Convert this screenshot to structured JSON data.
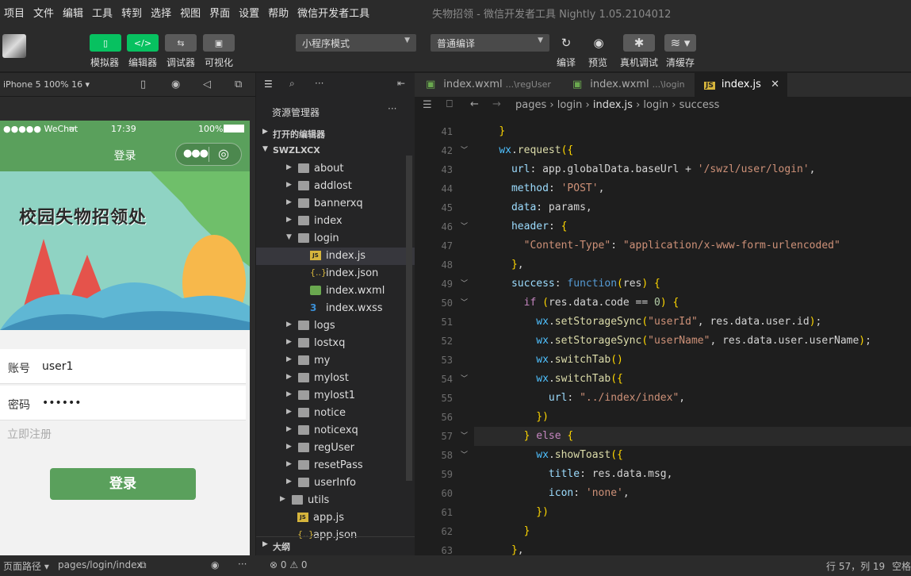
{
  "menu": [
    "项目",
    "文件",
    "编辑",
    "工具",
    "转到",
    "选择",
    "视图",
    "界面",
    "设置",
    "帮助",
    "微信开发者工具"
  ],
  "app_title": "失物招领 - 微信开发者工具 Nightly 1.05.2104012",
  "toolbar": {
    "simulator": "模拟器",
    "editor": "编辑器",
    "debugger": "调试器",
    "visual": "可视化",
    "mode_select": "小程序模式",
    "compile_select": "普通编译",
    "compile": "编译",
    "preview": "预览",
    "remote_debug": "真机调试",
    "clear_cache": "清缓存"
  },
  "simulator": {
    "device": "iPhone 5 100% 16 ▾",
    "carrier": "●●●●● WeChat",
    "time": "17:39",
    "battery": "100%",
    "nav_title": "登录",
    "banner_title": "校园失物招领处",
    "account_label": "账号",
    "account_value": "user1",
    "password_label": "密码",
    "password_value": "••••••",
    "register_link": "立即注册",
    "login_button": "登录"
  },
  "explorer": {
    "title": "资源管理器",
    "open_editors": "打开的编辑器",
    "project": "SWZLXCX",
    "outline": "大纲",
    "items": [
      {
        "name": "about",
        "type": "folder",
        "indent": 1,
        "open": false
      },
      {
        "name": "addlost",
        "type": "folder",
        "indent": 1,
        "open": false
      },
      {
        "name": "bannerxq",
        "type": "folder",
        "indent": 1,
        "open": false
      },
      {
        "name": "index",
        "type": "folder",
        "indent": 1,
        "open": false
      },
      {
        "name": "login",
        "type": "folder",
        "indent": 1,
        "open": true
      },
      {
        "name": "index.js",
        "type": "js",
        "indent": 2,
        "selected": true
      },
      {
        "name": "index.json",
        "type": "json",
        "indent": 2
      },
      {
        "name": "index.wxml",
        "type": "wxml",
        "indent": 2
      },
      {
        "name": "index.wxss",
        "type": "wxss",
        "indent": 2
      },
      {
        "name": "logs",
        "type": "folder",
        "indent": 1,
        "open": false
      },
      {
        "name": "lostxq",
        "type": "folder",
        "indent": 1,
        "open": false
      },
      {
        "name": "my",
        "type": "folder",
        "indent": 1,
        "open": false
      },
      {
        "name": "mylost",
        "type": "folder",
        "indent": 1,
        "open": false
      },
      {
        "name": "mylost1",
        "type": "folder",
        "indent": 1,
        "open": false
      },
      {
        "name": "notice",
        "type": "folder",
        "indent": 1,
        "open": false
      },
      {
        "name": "noticexq",
        "type": "folder",
        "indent": 1,
        "open": false
      },
      {
        "name": "regUser",
        "type": "folder",
        "indent": 1,
        "open": false
      },
      {
        "name": "resetPass",
        "type": "folder",
        "indent": 1,
        "open": false
      },
      {
        "name": "userInfo",
        "type": "folder",
        "indent": 1,
        "open": false
      },
      {
        "name": "utils",
        "type": "folder",
        "indent": 0,
        "open": false
      },
      {
        "name": "app.js",
        "type": "js",
        "indent": 0
      },
      {
        "name": "app.json",
        "type": "json",
        "indent": 0
      }
    ]
  },
  "tabs": [
    {
      "name": "index.wxml",
      "dir": "...\\regUser",
      "active": false
    },
    {
      "name": "index.wxml",
      "dir": "...\\login",
      "active": false
    },
    {
      "name": "index.js",
      "dir": "",
      "active": true
    }
  ],
  "breadcrumb": [
    "pages",
    "login",
    "index.js",
    "login",
    "success"
  ],
  "code": {
    "first_line": 41,
    "fold_lines": [
      42,
      46,
      49,
      50,
      54,
      57,
      58
    ],
    "current_line": 57,
    "lines": [
      "    }",
      "    wx.request({",
      "      url: app.globalData.baseUrl + '/swzl/user/login',",
      "      method: 'POST',",
      "      data: params,",
      "      header: {",
      "        \"Content-Type\": \"application/x-www-form-urlencoded\"",
      "      },",
      "      success: function(res) {",
      "        if (res.data.code == 0) {",
      "          wx.setStorageSync(\"userId\", res.data.user.id);",
      "          wx.setStorageSync(\"userName\", res.data.user.userName);",
      "          wx.switchTab()",
      "          wx.switchTab({",
      "            url: \"../index/index\",",
      "          })",
      "        } else {",
      "          wx.showToast({",
      "            title: res.data.msg,",
      "            icon: 'none',",
      "          })",
      "        }",
      "      },"
    ]
  },
  "status": {
    "path_label": "页面路径 ▾",
    "path": "pages/login/index",
    "problems": "⊗ 0 ⚠ 0",
    "cursor": "行 57，列 19",
    "indent": "空格"
  }
}
